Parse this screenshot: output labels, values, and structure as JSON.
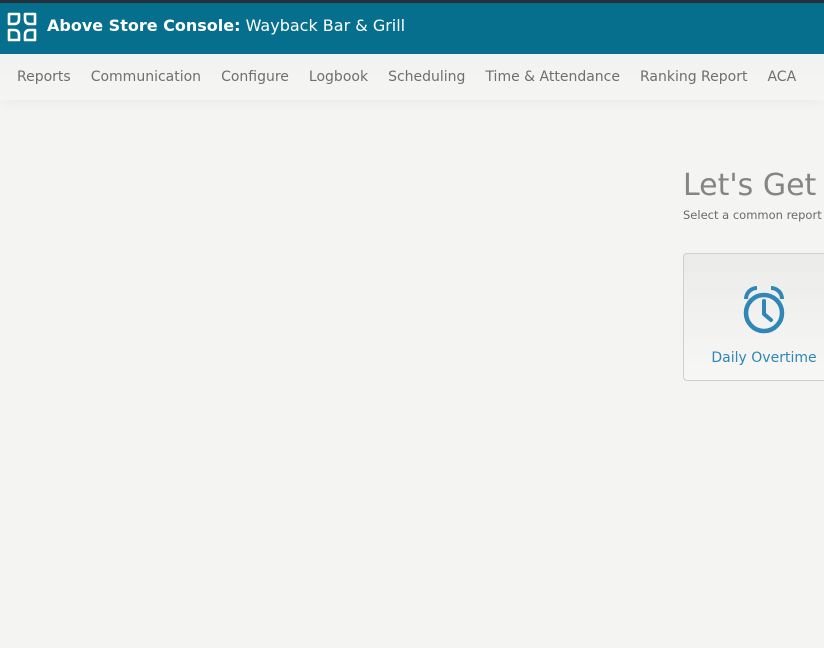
{
  "header": {
    "app_name": "Above Store Console:",
    "store_name": "Wayback Bar & Grill"
  },
  "nav": {
    "items": [
      {
        "label": "Reports"
      },
      {
        "label": "Communication"
      },
      {
        "label": "Configure"
      },
      {
        "label": "Logbook"
      },
      {
        "label": "Scheduling"
      },
      {
        "label": "Time & Attendance"
      },
      {
        "label": "Ranking Report"
      },
      {
        "label": "ACA"
      }
    ]
  },
  "main": {
    "heading": "Let's Get S",
    "subheading": "Select a common report b",
    "cards": [
      {
        "label": "Daily Overtime",
        "icon": "alarm-clock-icon"
      }
    ]
  },
  "colors": {
    "header_bg": "#076f8e",
    "accent": "#2f86b7",
    "page_bg": "#f4f4f3"
  }
}
